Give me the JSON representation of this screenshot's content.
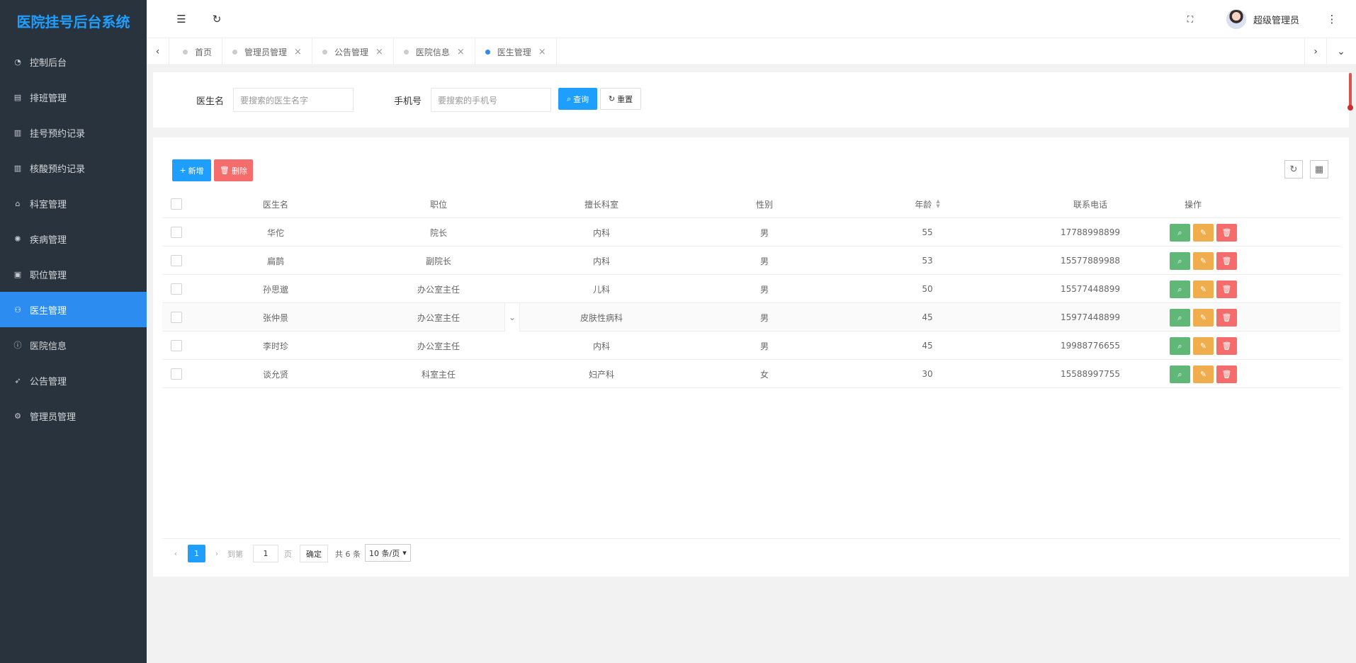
{
  "app": {
    "title": "医院挂号后台系统"
  },
  "sidebar": {
    "items": [
      {
        "label": "控制后台",
        "icon": "dashboard-icon"
      },
      {
        "label": "排班管理",
        "icon": "calendar-icon"
      },
      {
        "label": "挂号预约记录",
        "icon": "document-icon"
      },
      {
        "label": "核酸预约记录",
        "icon": "document-icon"
      },
      {
        "label": "科室管理",
        "icon": "home-icon"
      },
      {
        "label": "疾病管理",
        "icon": "virus-icon"
      },
      {
        "label": "职位管理",
        "icon": "badge-icon"
      },
      {
        "label": "医生管理",
        "icon": "user-icon"
      },
      {
        "label": "医院信息",
        "icon": "info-icon"
      },
      {
        "label": "公告管理",
        "icon": "send-icon"
      },
      {
        "label": "管理员管理",
        "icon": "gear-icon"
      }
    ],
    "active_index": 7
  },
  "header": {
    "user_name": "超级管理员"
  },
  "tabs": [
    {
      "label": "首页"
    },
    {
      "label": "管理员管理"
    },
    {
      "label": "公告管理"
    },
    {
      "label": "医院信息"
    },
    {
      "label": "医生管理"
    }
  ],
  "search": {
    "doctor_label": "医生名",
    "doctor_placeholder": "要搜索的医生名字",
    "phone_label": "手机号",
    "phone_placeholder": "要搜索的手机号",
    "query_label": "查询",
    "reset_label": "重置"
  },
  "toolbar": {
    "add_label": "新增",
    "delete_label": "删除"
  },
  "table": {
    "columns": [
      "医生名",
      "职位",
      "擅长科室",
      "性别",
      "年龄",
      "联系电话",
      "操作"
    ],
    "rows": [
      {
        "name": "华佗",
        "position": "院长",
        "dept": "内科",
        "gender": "男",
        "age": "55",
        "phone": "17788998899"
      },
      {
        "name": "扁鹊",
        "position": "副院长",
        "dept": "内科",
        "gender": "男",
        "age": "53",
        "phone": "15577889988"
      },
      {
        "name": "孙思邈",
        "position": "办公室主任",
        "dept": "儿科",
        "gender": "男",
        "age": "50",
        "phone": "15577448899"
      },
      {
        "name": "张仲景",
        "position": "办公室主任",
        "dept": "皮肤性病科",
        "gender": "男",
        "age": "45",
        "phone": "15977448899"
      },
      {
        "name": "李时珍",
        "position": "办公室主任",
        "dept": "内科",
        "gender": "男",
        "age": "45",
        "phone": "19988776655"
      },
      {
        "name": "谈允贤",
        "position": "科室主任",
        "dept": "妇产科",
        "gender": "女",
        "age": "30",
        "phone": "15588997755"
      }
    ]
  },
  "pagination": {
    "current_page": "1",
    "goto_label": "到第",
    "goto_value": "1",
    "page_unit": "页",
    "confirm_label": "确定",
    "total_text": "共 6 条",
    "page_size": "10 条/页"
  },
  "colors": {
    "accent": "#1e9fff",
    "sidebar_bg": "#28333e",
    "active_nav": "#2d8cf0",
    "view": "#5fb878",
    "edit": "#f0ad4e",
    "delete": "#f56c6c"
  }
}
